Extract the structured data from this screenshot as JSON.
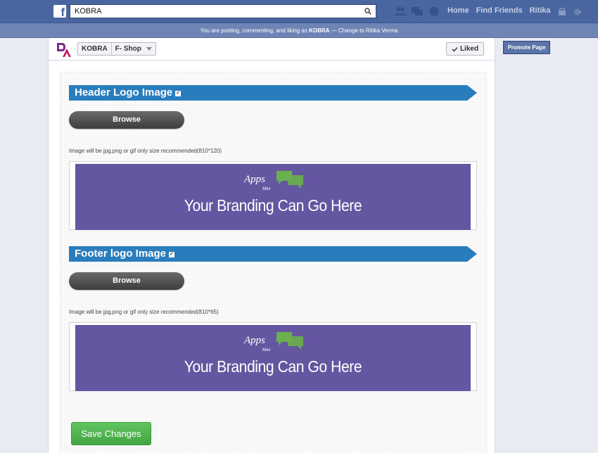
{
  "topbar": {
    "search_value": "KOBRA",
    "nav": [
      "Home",
      "Find Friends",
      "Ritika"
    ]
  },
  "posting": {
    "prefix": "You are posting, commenting, and liking as",
    "name": "KOBRA",
    "suffix": "— Change to Ritika Verma"
  },
  "page_header": {
    "page_name": "KOBRA",
    "app_name": "F- Shop",
    "liked_label": "Liked"
  },
  "promote_label": "Promote Page",
  "sections": [
    {
      "title": "Header Logo Image",
      "browse_label": "Browse",
      "hint": "Image will be jpg,png or gif only size recommended(810*120)",
      "banner_brand": "Apps",
      "banner_sub": "Mav",
      "banner_tagline": "Your Branding Can Go Here"
    },
    {
      "title": "Footer logo Image",
      "browse_label": "Browse",
      "hint": "Image will be jpg,png or gif only size recommended(810*65)",
      "banner_brand": "Apps",
      "banner_sub": "Mav",
      "banner_tagline": "Your Branding Can Go Here"
    }
  ],
  "save_label": "Save Changes",
  "colors": {
    "topbar": "#4a66a0",
    "ribbon": "#2a7dbd",
    "banner": "#6456a0",
    "save": "#4cb04b"
  }
}
